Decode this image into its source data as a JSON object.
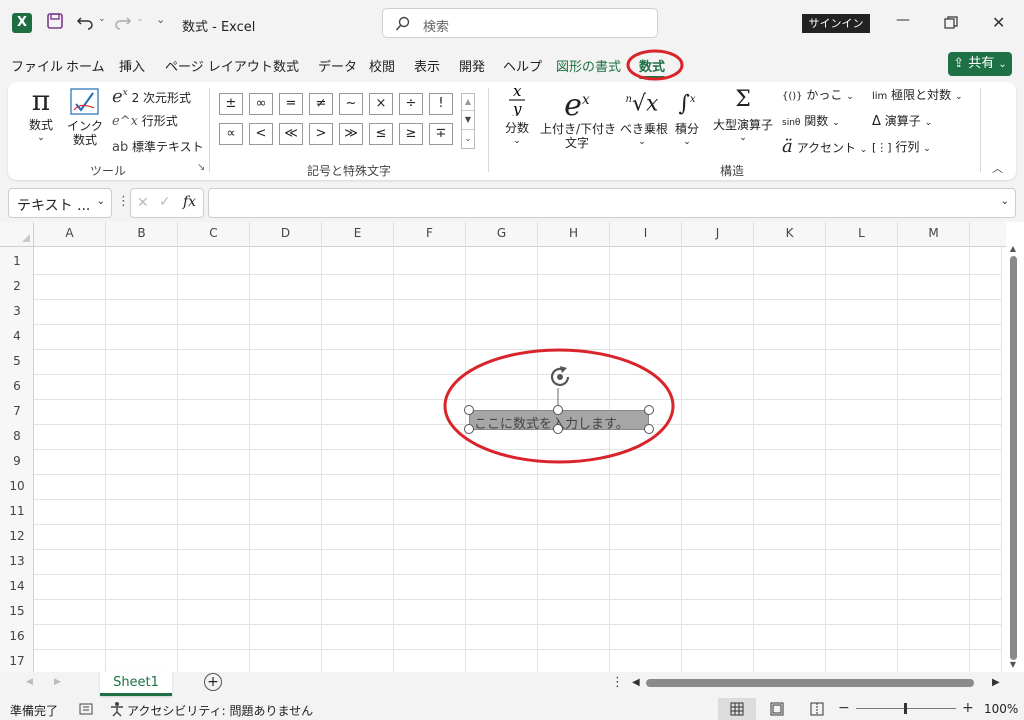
{
  "window": {
    "title": "数式  -  Excel",
    "search_placeholder": "検索",
    "signin_label": "サインイン",
    "share_label": "共有"
  },
  "menu": {
    "tabs": [
      "ファイル",
      "ホーム",
      "挿入",
      "ページ レイアウト",
      "数式",
      "データ",
      "校閲",
      "表示",
      "開発",
      "ヘルプ",
      "図形の書式",
      "数式"
    ],
    "active_tab": "数式"
  },
  "ribbon": {
    "tools": {
      "equation_label": "数式",
      "ink_label_1": "インク",
      "ink_label_2": "数式",
      "professional_label": "2 次元形式",
      "linear_label": "行形式",
      "normal_text_label": "標準テキスト",
      "group_label": "ツール"
    },
    "symbols": {
      "row1": [
        "±",
        "∞",
        "=",
        "≠",
        "~",
        "×",
        "÷",
        "!"
      ],
      "row2": [
        "∝",
        "<",
        "≪",
        ">",
        "≫",
        "≤",
        "≥",
        "∓"
      ],
      "group_label": "記号と特殊文字"
    },
    "structures": {
      "fraction_label": "分数",
      "script_label_1": "上付き/下付き",
      "script_label_2": "文字",
      "radical_label": "べき乗根",
      "integral_label": "積分",
      "large_operator_label": "大型演算子",
      "bracket_label": "かっこ",
      "function_label": "関数",
      "accent_label": "アクセント",
      "limit_label": "極限と対数",
      "operator_label": "演算子",
      "matrix_label": "行列",
      "group_label": "構造"
    }
  },
  "formula_bar": {
    "name_box": "テキスト ...",
    "fx": "fx"
  },
  "sheet": {
    "columns": [
      "A",
      "B",
      "C",
      "D",
      "E",
      "F",
      "G",
      "H",
      "I",
      "J",
      "K",
      "L",
      "M"
    ],
    "rows": [
      "1",
      "2",
      "3",
      "4",
      "5",
      "6",
      "7",
      "8",
      "9",
      "10",
      "11",
      "12",
      "13",
      "14",
      "15",
      "16",
      "17"
    ],
    "equation_placeholder": "ここに数式を入力します。"
  },
  "sheet_tabs": {
    "active": "Sheet1"
  },
  "status": {
    "ready": "準備完了",
    "accessibility": "アクセシビリティ: 問題ありません",
    "zoom": "100%"
  },
  "colors": {
    "accent": "#1e7145",
    "annotation": "#d9242b"
  }
}
